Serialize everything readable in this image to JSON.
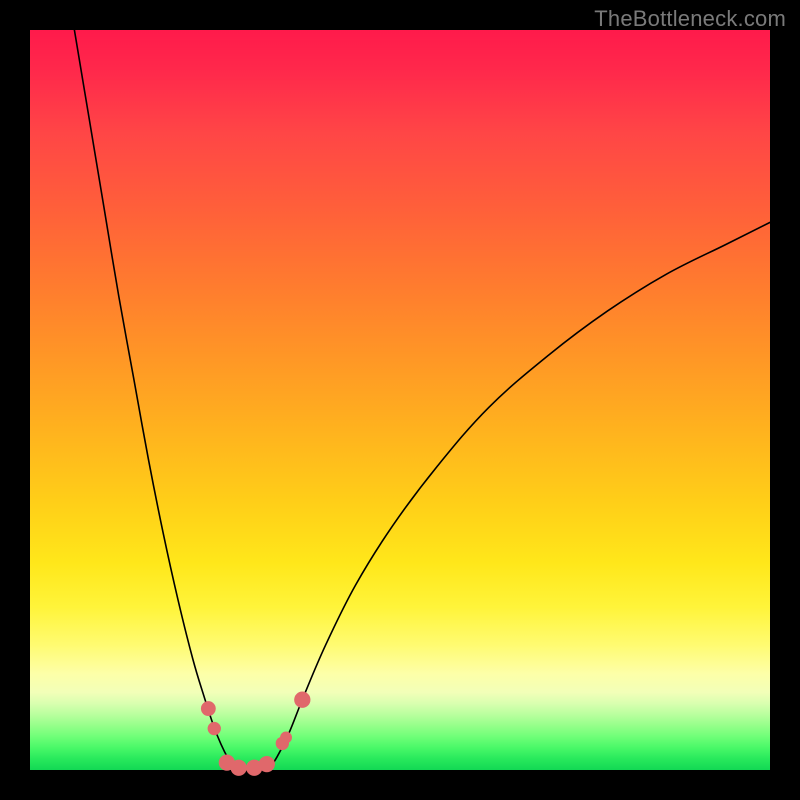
{
  "watermark": "TheBottleneck.com",
  "chart_data": {
    "type": "line",
    "title": "",
    "xlabel": "",
    "ylabel": "",
    "xlim": [
      0,
      100
    ],
    "ylim": [
      0,
      100
    ],
    "grid": false,
    "series": [
      {
        "name": "left-curve",
        "x": [
          6,
          8,
          10,
          12,
          14,
          16,
          18,
          20,
          22,
          23.5,
          24.8,
          25.8,
          26.8,
          27.6
        ],
        "y": [
          100,
          88,
          76,
          64,
          53,
          42,
          32,
          23,
          15,
          10,
          6,
          3.5,
          1.5,
          0.3
        ],
        "stroke": "#000000",
        "width": 1.6
      },
      {
        "name": "right-curve",
        "x": [
          32.4,
          33.4,
          35,
          37,
          40,
          44,
          49,
          55,
          62,
          70,
          78,
          86,
          94,
          100
        ],
        "y": [
          0.3,
          1.8,
          5,
          10,
          17,
          25,
          33,
          41,
          49,
          56,
          62,
          67,
          71,
          74
        ],
        "stroke": "#000000",
        "width": 1.6
      },
      {
        "name": "trough-floor",
        "x": [
          27.6,
          28.6,
          30.0,
          31.4,
          32.4
        ],
        "y": [
          0.3,
          0.0,
          0.0,
          0.0,
          0.3
        ],
        "stroke": "#000000",
        "width": 1.6
      }
    ],
    "markers": [
      {
        "name": "marker-left-a",
        "x": 24.1,
        "y": 8.3,
        "r": 1.0
      },
      {
        "name": "marker-left-b",
        "x": 24.9,
        "y": 5.6,
        "r": 0.9
      },
      {
        "name": "marker-bottom-a",
        "x": 26.6,
        "y": 1.0,
        "r": 1.1
      },
      {
        "name": "marker-bottom-b",
        "x": 28.2,
        "y": 0.3,
        "r": 1.1
      },
      {
        "name": "marker-bottom-c",
        "x": 30.3,
        "y": 0.3,
        "r": 1.1
      },
      {
        "name": "marker-bottom-d",
        "x": 32.0,
        "y": 0.8,
        "r": 1.1
      },
      {
        "name": "marker-right-a",
        "x": 34.1,
        "y": 3.6,
        "r": 0.9
      },
      {
        "name": "marker-right-b",
        "x": 34.6,
        "y": 4.4,
        "r": 0.8
      },
      {
        "name": "marker-right-c",
        "x": 36.8,
        "y": 9.5,
        "r": 1.1
      }
    ],
    "marker_color": "#e0686b",
    "annotations": []
  }
}
